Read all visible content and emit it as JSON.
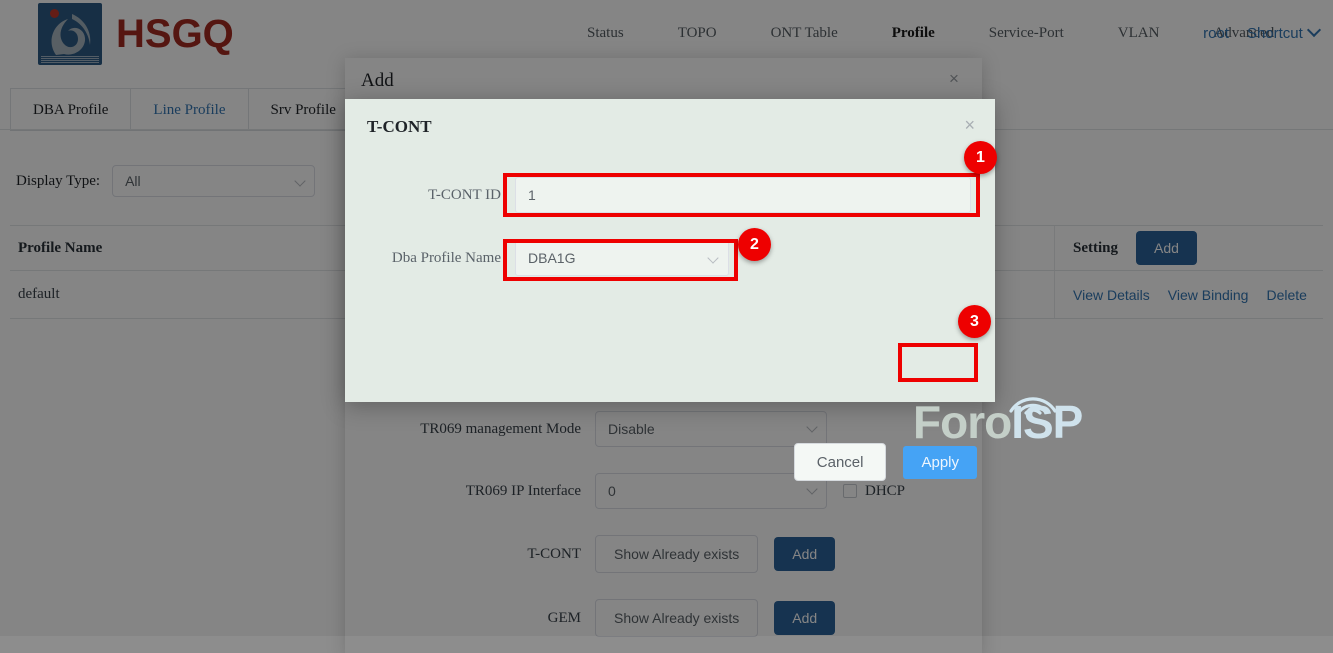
{
  "header": {
    "brand": "HSGQ",
    "nav": [
      {
        "label": "Status",
        "active": false
      },
      {
        "label": "TOPO",
        "active": false
      },
      {
        "label": "ONT Table",
        "active": false
      },
      {
        "label": "Profile",
        "active": true
      },
      {
        "label": "Service-Port",
        "active": false
      },
      {
        "label": "VLAN",
        "active": false
      },
      {
        "label": "Advanced",
        "active": false
      }
    ],
    "user": "root",
    "shortcut": "Shortcut"
  },
  "tabs": [
    {
      "label": "DBA Profile",
      "active": false
    },
    {
      "label": "Line Profile",
      "active": true
    },
    {
      "label": "Srv Profile",
      "active": false
    }
  ],
  "filter": {
    "label": "Display Type:",
    "value": "All"
  },
  "table": {
    "columns": {
      "name": "Profile Name",
      "setting": "Setting"
    },
    "add_button": "Add",
    "rows": [
      {
        "name": "default",
        "actions": [
          "View Details",
          "View Binding",
          "Delete"
        ]
      }
    ]
  },
  "add_modal": {
    "title": "Add",
    "close": "×",
    "fields": [
      {
        "label": "TR069 management Mode",
        "value": "Disable",
        "type": "select"
      },
      {
        "label": "TR069 IP Interface",
        "value": "0",
        "type": "select",
        "checkbox": "DHCP"
      },
      {
        "label": "T-CONT",
        "value": "Show Already exists",
        "type": "button",
        "add": "Add"
      },
      {
        "label": "GEM",
        "value": "Show Already exists",
        "type": "button",
        "add": "Add"
      }
    ]
  },
  "tcont_dialog": {
    "title": "T-CONT",
    "close": "×",
    "id_label": "T-CONT ID",
    "id_value": "1",
    "dba_label": "Dba Profile Name",
    "dba_value": "DBA1G",
    "cancel": "Cancel",
    "apply": "Apply"
  },
  "annotations": {
    "badge1": "1",
    "badge2": "2",
    "badge3": "3",
    "highlight_color": "#ee0000"
  },
  "watermark": {
    "part1": "Foro",
    "part2": "ISP"
  }
}
